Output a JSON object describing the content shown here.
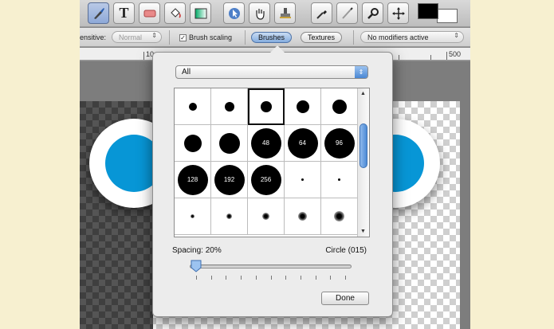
{
  "toolbar": {
    "tools": [
      {
        "name": "brush-tool",
        "icon": "paintbrush-icon",
        "active": true
      },
      {
        "name": "text-tool",
        "icon": "text-icon",
        "glyph": "T"
      },
      {
        "name": "eraser-tool",
        "icon": "eraser-icon"
      },
      {
        "name": "fill-tool",
        "icon": "paint-bucket-icon"
      },
      {
        "name": "gradient-tool",
        "icon": "gradient-icon"
      },
      {
        "name": "select-tool",
        "icon": "arrow-pointer-icon"
      },
      {
        "name": "pan-tool",
        "icon": "hand-icon"
      },
      {
        "name": "clone-tool",
        "icon": "stamp-icon"
      },
      {
        "name": "eyedropper-tool",
        "icon": "eyedropper-icon"
      },
      {
        "name": "smudge-tool",
        "icon": "smudge-icon"
      },
      {
        "name": "zoom-tool",
        "icon": "magnifier-icon"
      },
      {
        "name": "move-tool",
        "icon": "move-arrows-icon"
      }
    ],
    "foreground_color": "#000000",
    "background_color": "#ffffff"
  },
  "options": {
    "pressure_label": "ensitive:",
    "pressure_value": "Normal",
    "brush_scaling_label": "Brush scaling",
    "brush_scaling_checked": true,
    "brushes_tab": "Brushes",
    "textures_tab": "Textures",
    "modifiers_value": "No modifiers active"
  },
  "ruler": {
    "left_number": "10",
    "right_number": "500"
  },
  "brush_popover": {
    "category": "All",
    "brushes": [
      {
        "size": 10,
        "label": "",
        "soft": false
      },
      {
        "size": 12,
        "label": "",
        "soft": false
      },
      {
        "size": 14,
        "label": "",
        "soft": false,
        "selected": true
      },
      {
        "size": 16,
        "label": "",
        "soft": false
      },
      {
        "size": 18,
        "label": "",
        "soft": false
      },
      {
        "size": 22,
        "label": "",
        "soft": false
      },
      {
        "size": 26,
        "label": "",
        "soft": false
      },
      {
        "size": 38,
        "label": "48",
        "soft": false
      },
      {
        "size": 38,
        "label": "64",
        "soft": false
      },
      {
        "size": 38,
        "label": "96",
        "soft": false
      },
      {
        "size": 38,
        "label": "128",
        "soft": false
      },
      {
        "size": 38,
        "label": "192",
        "soft": false
      },
      {
        "size": 38,
        "label": "256",
        "soft": false
      },
      {
        "size": 3,
        "label": "",
        "soft": false
      },
      {
        "size": 3,
        "label": "",
        "soft": false
      },
      {
        "size": 5,
        "label": "",
        "soft": true
      },
      {
        "size": 7,
        "label": "",
        "soft": true
      },
      {
        "size": 9,
        "label": "",
        "soft": true
      },
      {
        "size": 11,
        "label": "",
        "soft": true
      },
      {
        "size": 13,
        "label": "",
        "soft": true
      }
    ],
    "spacing_label": "Spacing: 20%",
    "spacing_value": 0.2,
    "shape_label": "Circle (015)",
    "done_label": "Done"
  }
}
